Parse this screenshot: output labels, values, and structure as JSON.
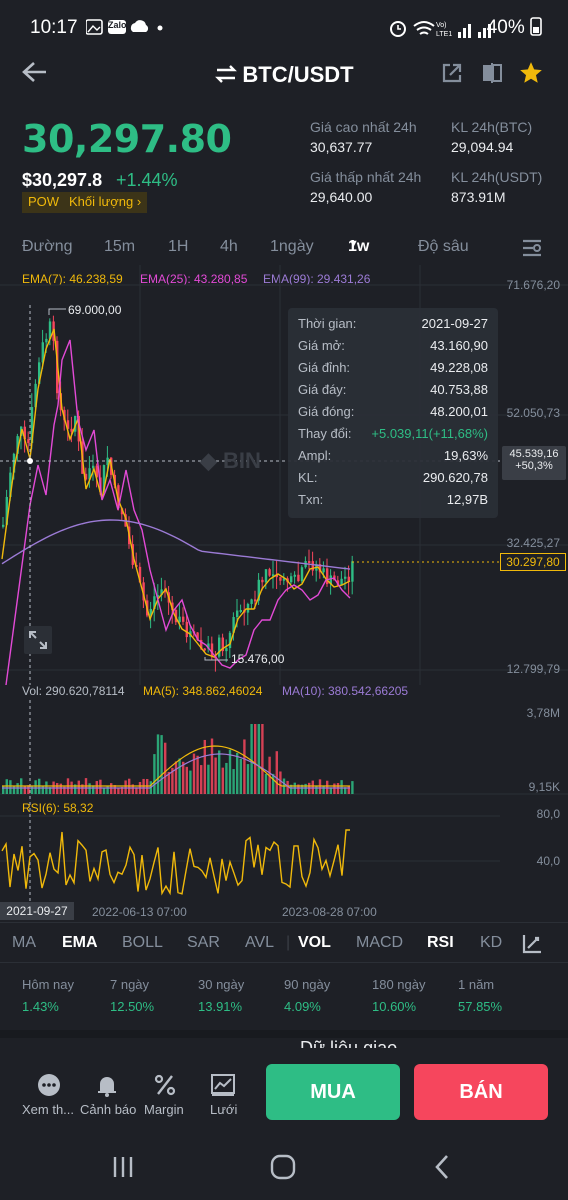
{
  "status_bar": {
    "time": "10:17",
    "battery": "40%",
    "notif_icons": "Zalo"
  },
  "header": {
    "title": "BTC/USDT"
  },
  "price": {
    "last": "30,297.80",
    "usd": "$30,297.8",
    "change": "+1.44%",
    "tag_pow": "POW",
    "tag_volume": "Khối lượng"
  },
  "stats": {
    "high_label": "Giá cao nhất 24h",
    "high_value": "30,637.77",
    "vol_btc_label": "KL 24h(BTC)",
    "vol_btc_value": "29,094.94",
    "low_label": "Giá thấp nhất 24h",
    "low_value": "29,640.00",
    "vol_usdt_label": "KL 24h(USDT)",
    "vol_usdt_value": "873.91M"
  },
  "intervals": [
    "Đường",
    "15m",
    "1H",
    "4h",
    "1ngày",
    "1w",
    "Độ sâu"
  ],
  "active_interval": "1w",
  "ema": {
    "ema7": "EMA(7): 46.238,59",
    "ema25": "EMA(25): 43.280,85",
    "ema99": "EMA(99): 29.431,26"
  },
  "price_axis": [
    "71.676,20",
    "52.050,73",
    "32.425,27",
    "12.799,79"
  ],
  "crosshair": {
    "price": "45.539,16",
    "pct": "+50,3%",
    "date": "2021-09-27"
  },
  "last_price_label": "30.297,80",
  "peak_label": "69.000,00",
  "trough_label": "15.476,00",
  "tooltip": [
    {
      "k": "Thời gian:",
      "v": "2021-09-27"
    },
    {
      "k": "Giá mở:",
      "v": "43.160,90"
    },
    {
      "k": "Giá đỉnh:",
      "v": "49.228,08"
    },
    {
      "k": "Giá đáy:",
      "v": "40.753,88"
    },
    {
      "k": "Giá đóng:",
      "v": "48.200,01"
    },
    {
      "k": "Thay đổi:",
      "v": "+5.039,11(+11,68%)"
    },
    {
      "k": "Ampl:",
      "v": "19,63%"
    },
    {
      "k": "KL:",
      "v": "290.620,78"
    },
    {
      "k": "Txn:",
      "v": "12,97B"
    }
  ],
  "volume": {
    "vol": "Vol: 290.620,78114",
    "ma5": "MA(5): 348.862,46024",
    "ma10": "MA(10): 380.542,66205",
    "axis_top": "3,78M",
    "axis_bottom": "9,15K"
  },
  "rsi": {
    "label": "RSI(6): 58,32",
    "axis_top": "80,0",
    "axis_mid": "40,0"
  },
  "time_axis": [
    "2022-06-13 07:00",
    "2023-08-28 07:00"
  ],
  "indicators": [
    "MA",
    "EMA",
    "BOLL",
    "SAR",
    "AVL",
    "VOL",
    "MACD",
    "RSI",
    "KD"
  ],
  "performance": [
    {
      "label": "Hôm nay",
      "value": "1.43%"
    },
    {
      "label": "7 ngày",
      "value": "12.50%"
    },
    {
      "label": "30 ngày",
      "value": "13.91%"
    },
    {
      "label": "90 ngày",
      "value": "4.09%"
    },
    {
      "label": "180 ngày",
      "value": "10.60%"
    },
    {
      "label": "1 năm",
      "value": "57.85%"
    }
  ],
  "partial_section": "Dữ liệu giao",
  "bottom_actions": [
    "Xem th...",
    "Cảnh báo",
    "Margin",
    "Lưới"
  ],
  "buy_label": "MUA",
  "sell_label": "BÁN",
  "colors": {
    "up": "#2ebd85",
    "down": "#f6465d",
    "ema7": "#f0b90b",
    "ema25": "#e24ad6",
    "ema99": "#9c7bd6",
    "bg": "#1e2026"
  }
}
